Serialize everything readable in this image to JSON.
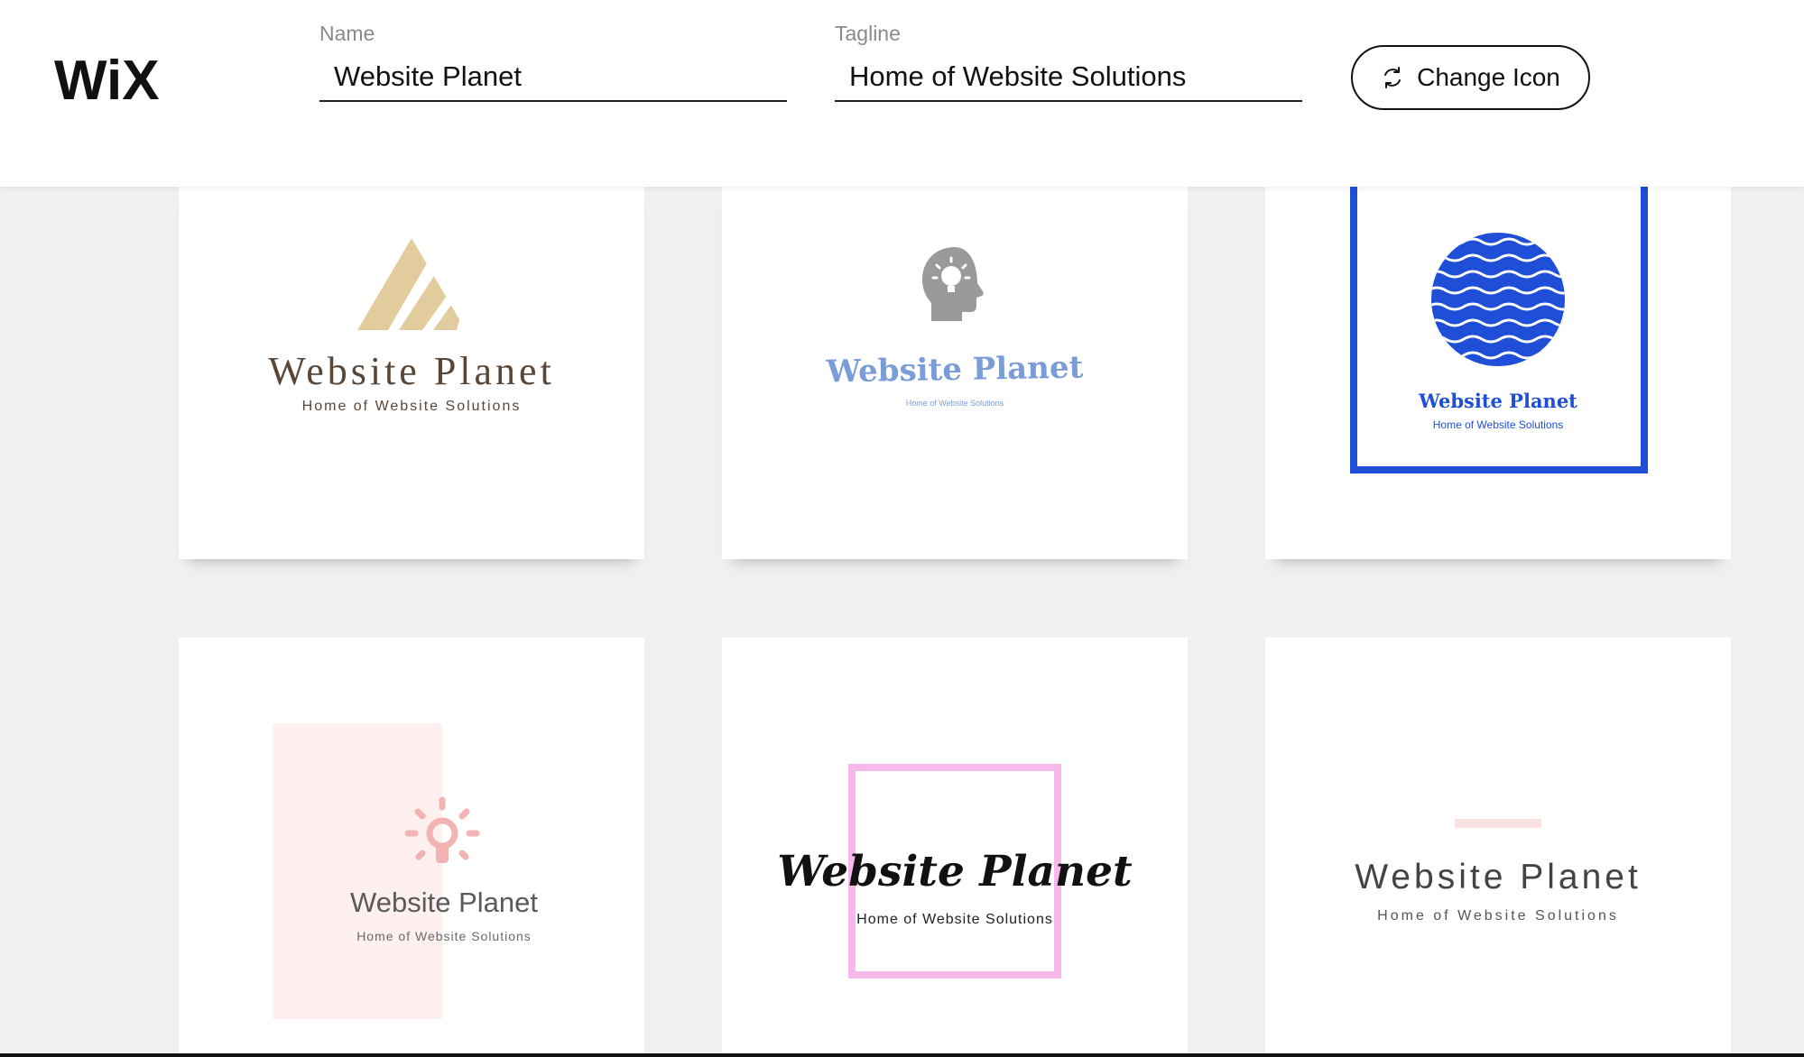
{
  "header": {
    "brand": "WiX",
    "name_field": {
      "label": "Name",
      "value": "Website Planet"
    },
    "tagline_field": {
      "label": "Tagline",
      "value": "Home of Website Solutions"
    },
    "change_icon_label": "Change Icon",
    "change_icon_icon": "refresh-icon"
  },
  "logos": [
    {
      "name": "Website Planet",
      "tagline": "Home of Website Solutions",
      "icon": "triangle-stripes-icon",
      "colors": {
        "icon": "#e2cc9e",
        "text": "#5a4637"
      }
    },
    {
      "name": "Website Planet",
      "tagline": "Home of Website Solutions",
      "icon": "head-lightbulb-icon",
      "colors": {
        "icon": "#9a9a9a",
        "text": "#7a9cd8"
      }
    },
    {
      "name": "Website Planet",
      "tagline": "Home of Website Solutions",
      "icon": "wave-globe-icon",
      "colors": {
        "icon": "#1e4fd6",
        "text": "#1e4fd6"
      }
    },
    {
      "name": "Website Planet",
      "tagline": "Home of Website Solutions",
      "icon": "lightbulb-icon",
      "colors": {
        "icon": "#f4b3b3",
        "background": "#fdf0ef",
        "text": "#5a5a5a"
      }
    },
    {
      "name": "Website Planet",
      "tagline": "Home of Website Solutions",
      "icon": "square-frame-icon",
      "colors": {
        "icon": "#f7b8ec",
        "text": "#111111"
      }
    },
    {
      "name": "Website Planet",
      "tagline": "Home of Website Solutions",
      "icon": "dash-icon",
      "colors": {
        "icon": "#fbe3e3",
        "text": "#444444"
      }
    }
  ]
}
